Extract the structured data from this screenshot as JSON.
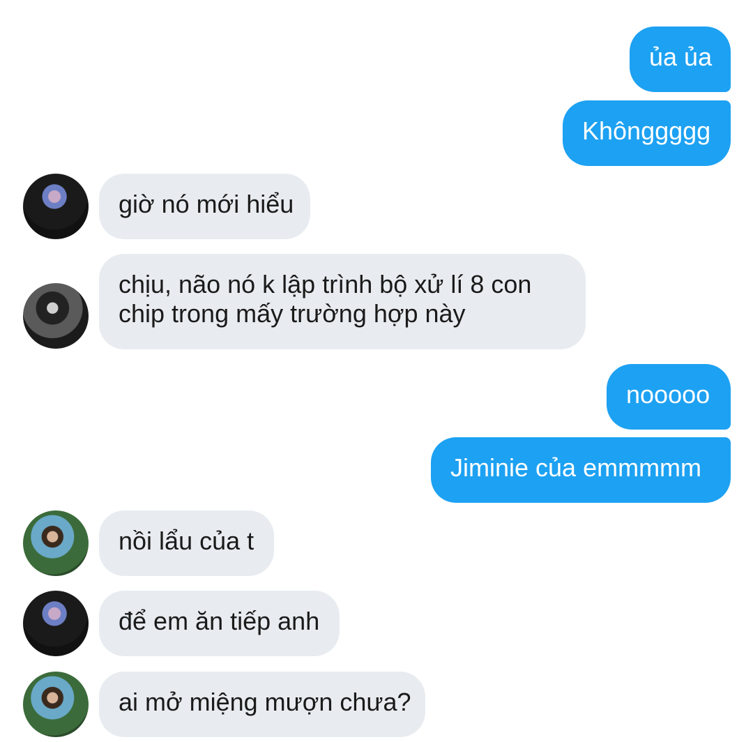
{
  "messages": [
    {
      "side": "out",
      "text": "ủa ủa"
    },
    {
      "side": "out",
      "text": "Khônggggg"
    },
    {
      "side": "in",
      "avatar": "avatar-1",
      "text": "giờ nó mới hiểu"
    },
    {
      "side": "in",
      "avatar": "avatar-2",
      "text": "chịu, não nó k lập trình bộ xử lí 8 con chip trong mấy trường hợp này"
    },
    {
      "side": "out",
      "text": "nooooo"
    },
    {
      "side": "out",
      "text": "Jiminie của emmmmm"
    },
    {
      "side": "in",
      "avatar": "avatar-3",
      "text": "nồi lẩu của t"
    },
    {
      "side": "in",
      "avatar": "avatar-1",
      "text": "để em ăn tiếp anh"
    },
    {
      "side": "in",
      "avatar": "avatar-3",
      "text": "ai mở miệng mượn chưa?"
    }
  ],
  "colors": {
    "outgoing_bubble": "#1da1f2",
    "incoming_bubble": "#e8ecf0",
    "background": "#ffffff"
  }
}
